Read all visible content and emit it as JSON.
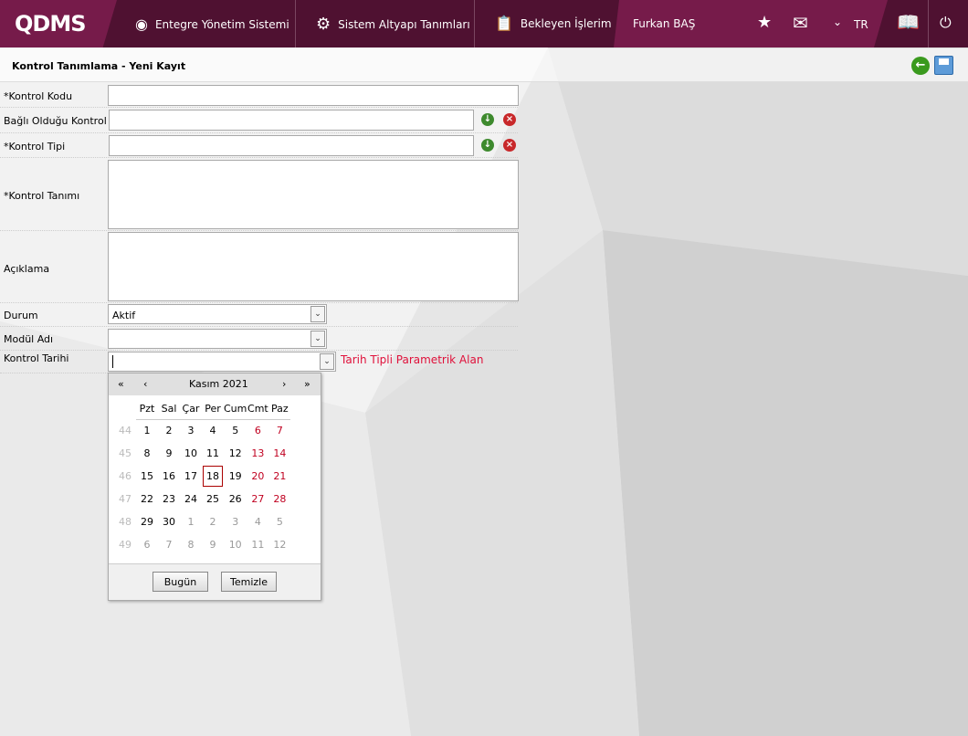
{
  "header": {
    "logo": "QDMS",
    "nav": [
      "Entegre Yönetim Sistemi",
      "Sistem Altyapı Tanımları",
      "Bekleyen İşlerim"
    ],
    "user": "Furkan BAŞ",
    "lang": "TR"
  },
  "page": {
    "title": "Kontrol Tanımlama - Yeni Kayıt"
  },
  "form": {
    "kontrol_kodu": "*Kontrol Kodu",
    "bagli": "Bağlı Olduğu Kontrol",
    "tipi": "*Kontrol Tipi",
    "tanimi": "*Kontrol Tanımı",
    "aciklama": "Açıklama",
    "durum": "Durum",
    "durum_value": "Aktif",
    "modul": "Modül Adı",
    "tarih": "Kontrol Tarihi",
    "tarih_note": "Tarih Tipli Parametrik Alan"
  },
  "calendar": {
    "month": "Kasım 2021",
    "prev_year": "«",
    "prev": "‹",
    "next": "›",
    "next_year": "»",
    "days": [
      "Pzt",
      "Sal",
      "Çar",
      "Per",
      "Cum",
      "Cmt",
      "Paz"
    ],
    "weeks": [
      {
        "wk": "44",
        "d": [
          [
            "1",
            ""
          ],
          [
            "2",
            ""
          ],
          [
            "3",
            ""
          ],
          [
            "4",
            ""
          ],
          [
            "5",
            ""
          ],
          [
            "6",
            "we"
          ],
          [
            "7",
            "we"
          ]
        ]
      },
      {
        "wk": "45",
        "d": [
          [
            "8",
            ""
          ],
          [
            "9",
            ""
          ],
          [
            "10",
            ""
          ],
          [
            "11",
            ""
          ],
          [
            "12",
            ""
          ],
          [
            "13",
            "we"
          ],
          [
            "14",
            "we"
          ]
        ]
      },
      {
        "wk": "46",
        "d": [
          [
            "15",
            ""
          ],
          [
            "16",
            ""
          ],
          [
            "17",
            ""
          ],
          [
            "18",
            "sel18"
          ],
          [
            "19",
            ""
          ],
          [
            "20",
            "we"
          ],
          [
            "21",
            "we"
          ]
        ]
      },
      {
        "wk": "47",
        "d": [
          [
            "22",
            ""
          ],
          [
            "23",
            ""
          ],
          [
            "24",
            ""
          ],
          [
            "25",
            ""
          ],
          [
            "26",
            ""
          ],
          [
            "27",
            "we"
          ],
          [
            "28",
            "we"
          ]
        ]
      },
      {
        "wk": "48",
        "d": [
          [
            "29",
            ""
          ],
          [
            "30",
            ""
          ],
          [
            "1",
            "oth"
          ],
          [
            "2",
            "oth"
          ],
          [
            "3",
            "oth"
          ],
          [
            "4",
            "oth"
          ],
          [
            "5",
            "oth"
          ]
        ]
      },
      {
        "wk": "49",
        "d": [
          [
            "6",
            "oth"
          ],
          [
            "7",
            "oth"
          ],
          [
            "8",
            "oth"
          ],
          [
            "9",
            "oth"
          ],
          [
            "10",
            "oth"
          ],
          [
            "11",
            "oth"
          ],
          [
            "12",
            "oth"
          ]
        ]
      }
    ],
    "today": "Bugün",
    "clear": "Temizle"
  }
}
